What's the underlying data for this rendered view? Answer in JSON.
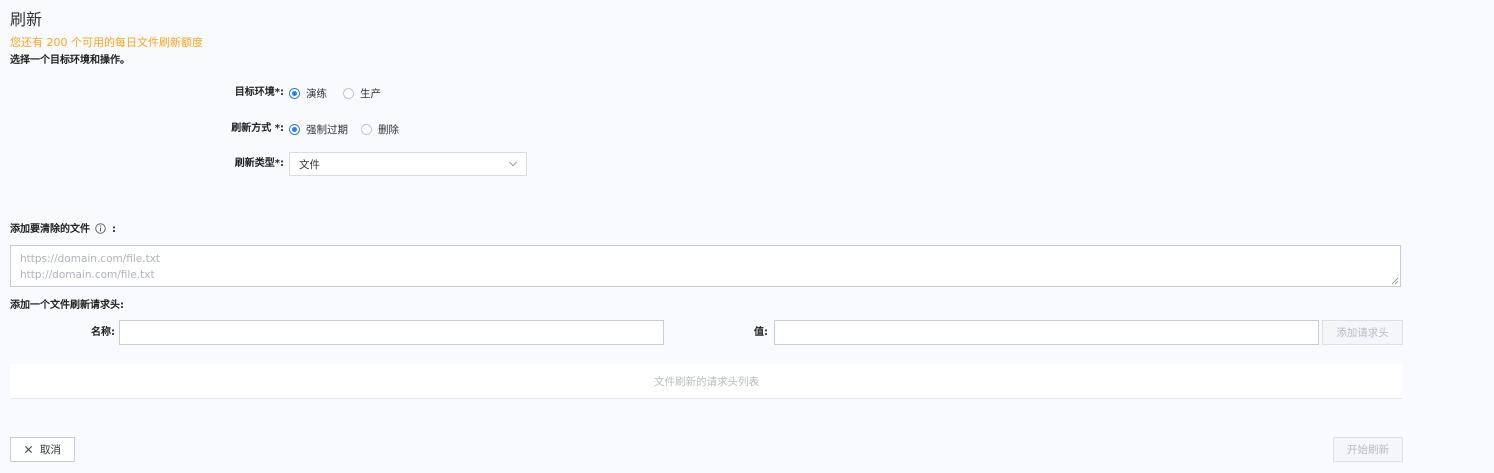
{
  "page": {
    "title": "刷新",
    "quota_text": "您还有 200 个可用的每日文件刷新额度",
    "intro": "选择一个目标环境和操作。"
  },
  "colors": {
    "background": "#f9fafd",
    "quota": "#f5a623",
    "radio_accent": "#2a7fe4",
    "disabled_text": "#b8bbc2"
  },
  "form": {
    "environment": {
      "label": "目标环境*:",
      "options": [
        {
          "label": "演练",
          "checked": true
        },
        {
          "label": "生产",
          "checked": false
        }
      ]
    },
    "method": {
      "label": "刷新方式 *:",
      "options": [
        {
          "label": "强制过期",
          "checked": true
        },
        {
          "label": "删除",
          "checked": false
        }
      ]
    },
    "type": {
      "label": "刷新类型*:",
      "value": "文件",
      "icon": "chevron-down-icon"
    }
  },
  "files": {
    "label": "添加要清除的文件",
    "label_suffix": ":",
    "info_icon": "info-icon",
    "placeholder_lines": [
      "https://domain.com/file.txt",
      "http://domain.com/file.txt"
    ]
  },
  "headers": {
    "label": "添加一个文件刷新请求头:",
    "name_label": "名称:",
    "name_value": "",
    "value_label": "值:",
    "value_value": "",
    "add_button": "添加请求头",
    "list_empty": "文件刷新的请求头列表"
  },
  "footer": {
    "cancel_label": "取消",
    "cancel_icon": "close-icon",
    "start_label": "开始刷新"
  }
}
